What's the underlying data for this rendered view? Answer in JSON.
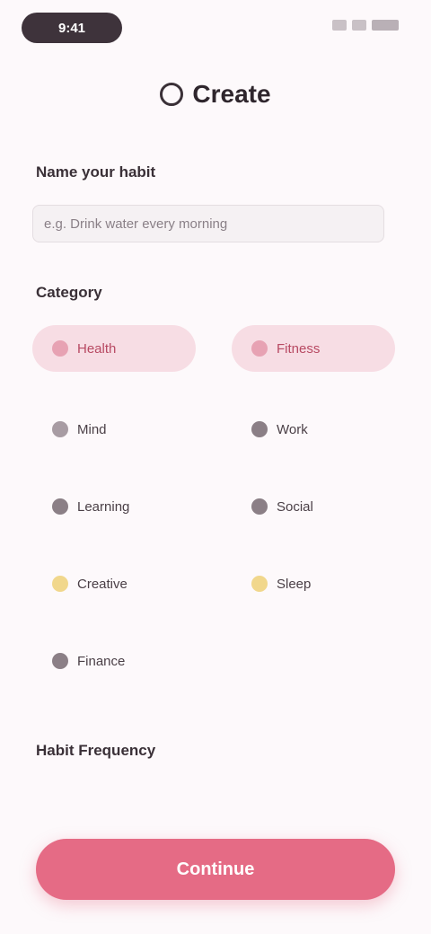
{
  "status_bar": {
    "time": "9:41"
  },
  "header": {
    "icon": "circle-icon",
    "title": "Create"
  },
  "name_section": {
    "title": "Name your habit",
    "placeholder": "e.g. Drink water every morning"
  },
  "category_section": {
    "title": "Category",
    "items": [
      {
        "label": "Health",
        "selected": true,
        "icon": "heart-icon"
      },
      {
        "label": "Fitness",
        "selected": true,
        "icon": "dumbbell-icon"
      },
      {
        "label": "Mind",
        "selected": false,
        "icon": "brain-icon"
      },
      {
        "label": "Work",
        "selected": false,
        "icon": "briefcase-icon"
      },
      {
        "label": "Learning",
        "selected": false,
        "icon": "book-icon"
      },
      {
        "label": "Social",
        "selected": false,
        "icon": "people-icon"
      },
      {
        "label": "Creative",
        "selected": false,
        "icon": "sparkle-icon"
      },
      {
        "label": "Sleep",
        "selected": false,
        "icon": "moon-icon"
      },
      {
        "label": "Finance",
        "selected": false,
        "icon": "wallet-icon"
      }
    ]
  },
  "extra_section": {
    "title": "Habit Frequency"
  },
  "primary_button": {
    "label": "Continue"
  },
  "colors": {
    "accent": "#e56b85",
    "chip_selected_bg": "#f7dde4",
    "background": "#fdf9fb"
  }
}
